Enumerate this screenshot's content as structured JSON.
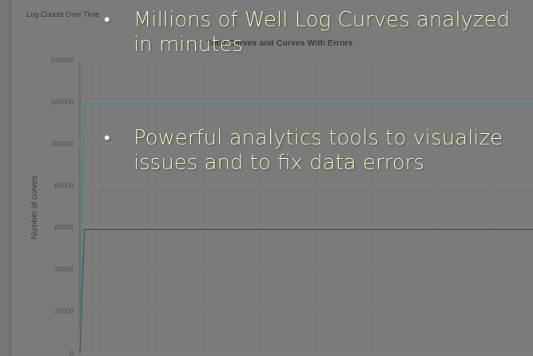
{
  "window": {
    "title": "Log Counts Over Time"
  },
  "bullets": [
    {
      "text": "Millions of Well Log Curves analyzed in minutes"
    },
    {
      "text": "Powerful analytics tools to visualize issues and to fix data errors"
    }
  ],
  "colors": {
    "background": "#7b7b7b",
    "bullet_text": "#e9f0b2",
    "total_series": "#3d8f8c",
    "error_series": "#4f5a4f"
  },
  "chart_data": {
    "type": "line",
    "title": "Total Curves and Curves With Errors",
    "xlabel": "",
    "ylabel": "Number of curves",
    "ylim": [
      0,
      140000
    ],
    "yticks": [
      0,
      20000,
      40000,
      60000,
      80000,
      100000,
      120000,
      140000
    ],
    "grid": true,
    "series": [
      {
        "values": [
          0,
          119000,
          119000
        ],
        "color": "#3d8f8c"
      },
      {
        "values": [
          0,
          59000,
          59000
        ],
        "color": "#4f5a4f"
      }
    ],
    "x": [
      0,
      0.01,
      1
    ]
  }
}
